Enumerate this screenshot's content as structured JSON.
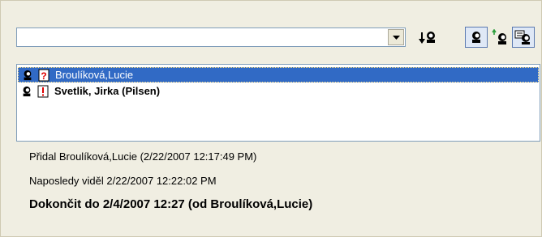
{
  "toolbar": {
    "combo_value": "",
    "combo_dropdown_icon": "dropdown-arrow-icon",
    "buttons": [
      {
        "icon": "sort-down-user-icon"
      },
      {
        "icon": "user-icon"
      },
      {
        "icon": "user-forward-icon"
      },
      {
        "icon": "user-message-icon"
      }
    ]
  },
  "list": {
    "items": [
      {
        "name": "Broulíková,Lucie",
        "status_icon": "question-icon",
        "selected": true
      },
      {
        "name": "Svetlik, Jirka (Pilsen)",
        "status_icon": "exclamation-icon",
        "selected": false
      }
    ]
  },
  "details": {
    "added_by": "Přidal Broulíková,Lucie (2/22/2007 12:17:49 PM)",
    "last_seen": "Naposledy viděl 2/22/2007 12:22:02 PM",
    "due": "Dokončit do 2/4/2007 12:27 (od Broulíková,Lucie)"
  },
  "colors": {
    "selection": "#316ac5",
    "panel": "#f0eee2",
    "border": "#7f9db9"
  }
}
